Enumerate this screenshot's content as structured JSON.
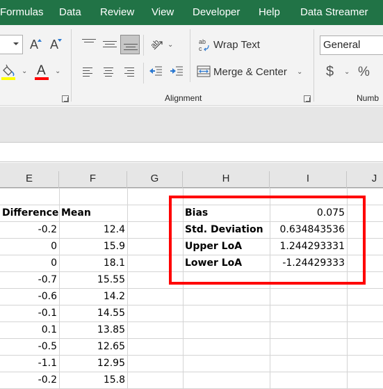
{
  "ribbon_tabs": [
    "Formulas",
    "Data",
    "Review",
    "View",
    "Developer",
    "Help",
    "Data Streamer"
  ],
  "ribbon": {
    "font_group": {
      "increase_font_icon": "increase-font-size-icon",
      "decrease_font_icon": "decrease-font-size-icon",
      "fill_color": "#ffff00",
      "font_color": "#ff0000"
    },
    "alignment_group": {
      "label": "Alignment",
      "wrap_text_label": "Wrap Text",
      "merge_center_label": "Merge & Center"
    },
    "number_group": {
      "label": "Numb",
      "format_value": "General",
      "currency_symbol": "$",
      "percent_symbol": "%"
    }
  },
  "columns": [
    "E",
    "F",
    "G",
    "H",
    "I",
    "J"
  ],
  "table": {
    "headers": [
      "Difference",
      "Mean"
    ],
    "rows": [
      [
        "-0.2",
        "12.4"
      ],
      [
        "0",
        "15.9"
      ],
      [
        "0",
        "18.1"
      ],
      [
        "-0.7",
        "15.55"
      ],
      [
        "-0.6",
        "14.2"
      ],
      [
        "-0.1",
        "14.55"
      ],
      [
        "0.1",
        "13.85"
      ],
      [
        "-0.5",
        "12.65"
      ],
      [
        "-1.1",
        "12.95"
      ],
      [
        "-0.2",
        "15.8"
      ]
    ]
  },
  "stats": [
    {
      "label": "Bias",
      "value": "0.075"
    },
    {
      "label": "Std. Deviation",
      "value": "0.634843536"
    },
    {
      "label": "Upper LoA",
      "value": "1.244293331"
    },
    {
      "label": "Lower LoA",
      "value": "-1.24429333"
    }
  ],
  "highlight_color": "#ff0000",
  "accent_color": "#217346"
}
